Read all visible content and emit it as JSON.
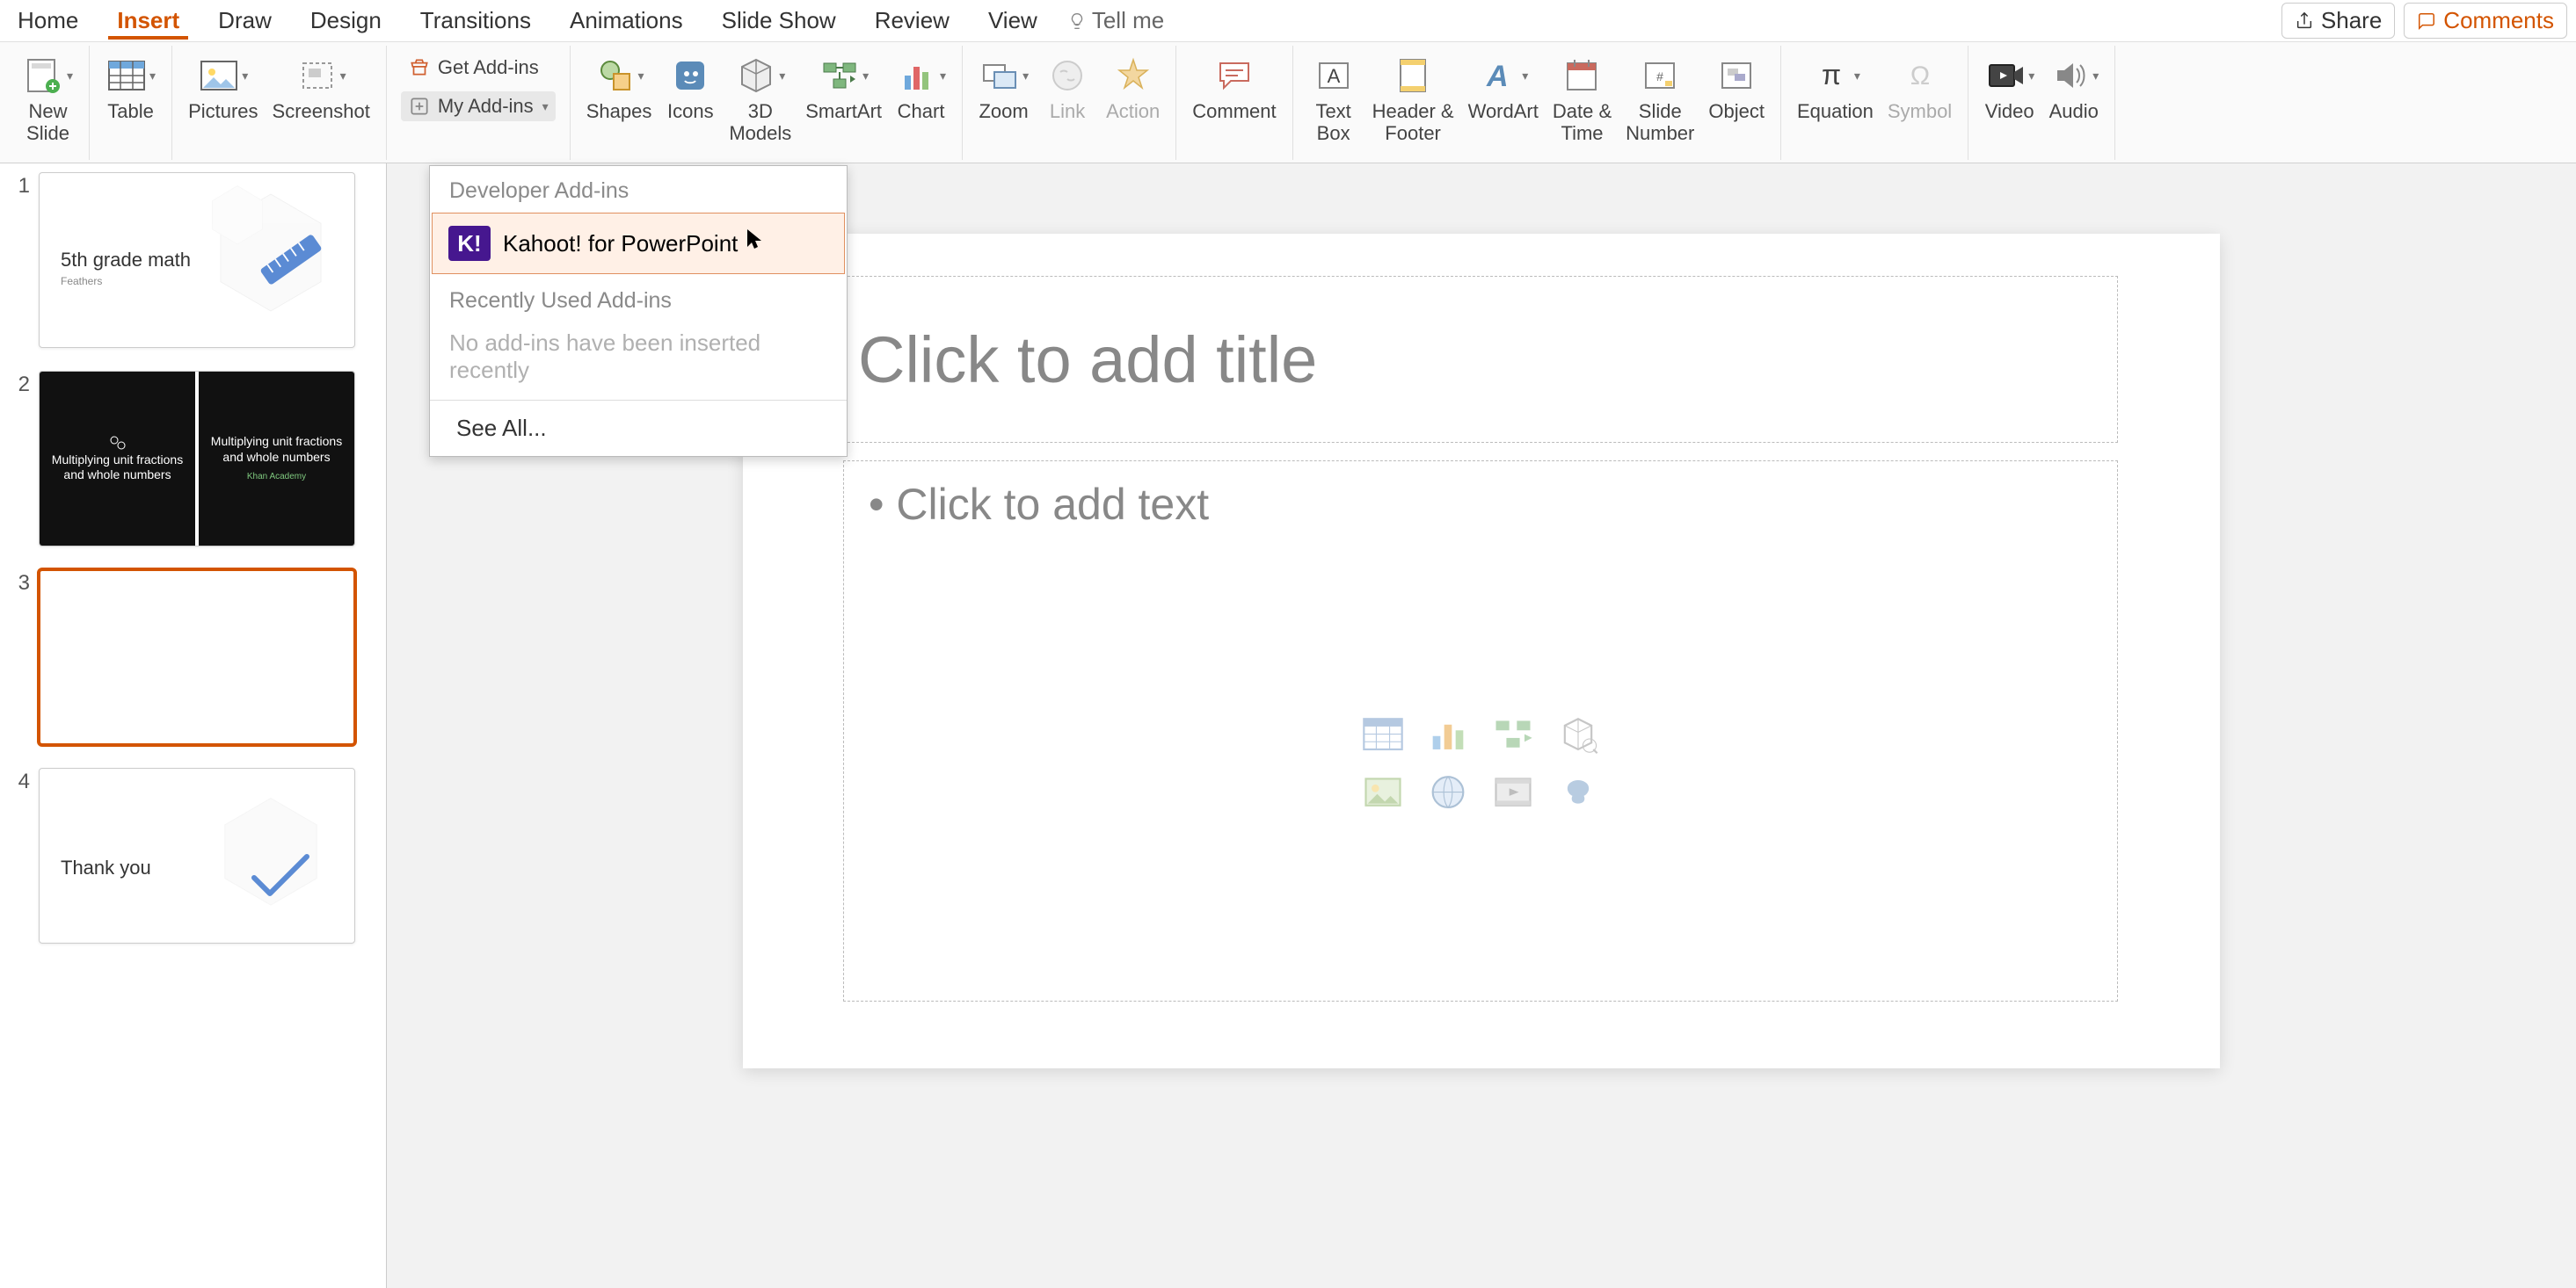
{
  "tabs": {
    "home": "Home",
    "insert": "Insert",
    "draw": "Draw",
    "design": "Design",
    "transitions": "Transitions",
    "animations": "Animations",
    "slideshow": "Slide Show",
    "review": "Review",
    "view": "View",
    "tellme": "Tell me"
  },
  "top_right": {
    "share": "Share",
    "comments": "Comments"
  },
  "ribbon": {
    "new_slide": "New\nSlide",
    "table": "Table",
    "pictures": "Pictures",
    "screenshot": "Screenshot",
    "get_addins": "Get Add-ins",
    "my_addins": "My Add-ins",
    "shapes": "Shapes",
    "icons": "Icons",
    "models": "3D\nModels",
    "smartart": "SmartArt",
    "chart": "Chart",
    "zoom": "Zoom",
    "link": "Link",
    "action": "Action",
    "comment": "Comment",
    "textbox": "Text\nBox",
    "header": "Header &\nFooter",
    "wordart": "WordArt",
    "datetime": "Date &\nTime",
    "slidenum": "Slide\nNumber",
    "object": "Object",
    "equation": "Equation",
    "symbol": "Symbol",
    "video": "Video",
    "audio": "Audio"
  },
  "addins": {
    "dev_header": "Developer Add-ins",
    "kahoot": "Kahoot! for PowerPoint",
    "recent_header": "Recently Used Add-ins",
    "no_recent": "No add-ins have been inserted recently",
    "see_all": "See All..."
  },
  "thumbs": {
    "n1": "1",
    "n2": "2",
    "n3": "3",
    "n4": "4",
    "s1_title": "5th grade math",
    "s1_sub": "Feathers",
    "s2_a": "Multiplying unit fractions and whole numbers",
    "s2_b": "Multiplying unit fractions and whole numbers",
    "s2_ka": "Khan Academy",
    "s4_title": "Thank you"
  },
  "canvas": {
    "title_ph": "Click to add title",
    "body_ph": "• Click to add text"
  }
}
